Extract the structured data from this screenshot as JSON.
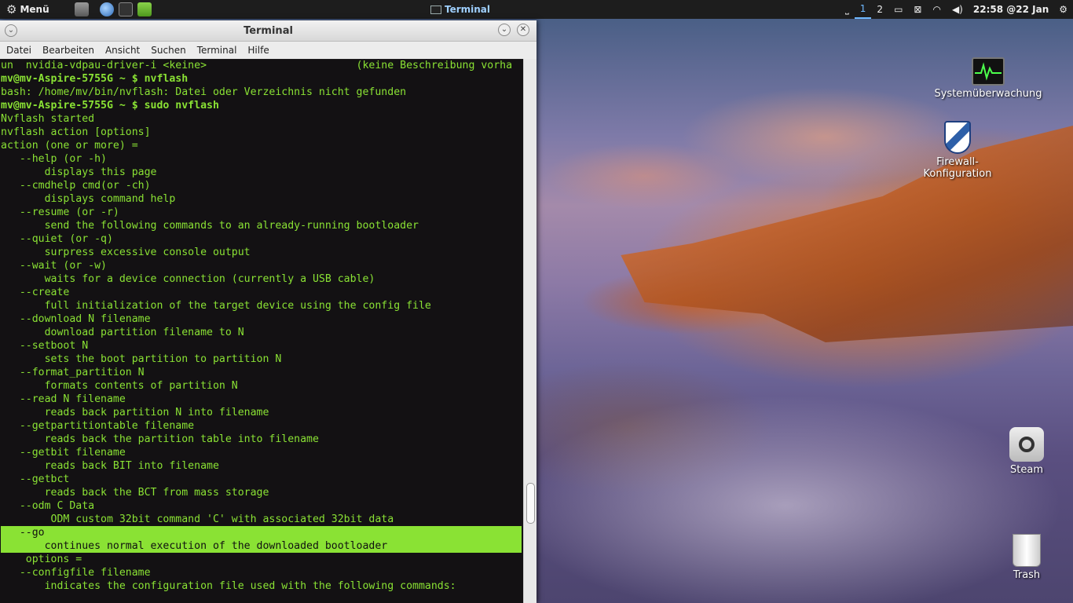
{
  "top_panel": {
    "menu_label": "Menü",
    "taskbar_active": "Terminal",
    "workspaces": [
      "1",
      "2"
    ],
    "clock": "22:58 @22 Jan",
    "icons": {
      "menu": "gear-icon",
      "files": "file-manager-icon",
      "browser": "browser-icon",
      "monitor": "system-monitor-icon",
      "folder": "folder-icon",
      "show_desktop": "show-desktop-icon",
      "display": "display-icon",
      "screen_off": "screen-off-icon",
      "wifi": "wifi-icon",
      "volume": "volume-icon",
      "settings": "settings-icon"
    }
  },
  "window": {
    "title": "Terminal",
    "menus": [
      "Datei",
      "Bearbeiten",
      "Ansicht",
      "Suchen",
      "Terminal",
      "Hilfe"
    ]
  },
  "terminal": {
    "lines": [
      {
        "t": "un  nvidia-vdpau-driver-i <keine>                        (keine Beschreibung vorha"
      },
      {
        "t": "mv@mv-Aspire-5755G ~ $ nvflash",
        "b": true
      },
      {
        "t": "bash: /home/mv/bin/nvflash: Datei oder Verzeichnis nicht gefunden"
      },
      {
        "t": "mv@mv-Aspire-5755G ~ $ sudo nvflash",
        "b": true
      },
      {
        "t": "Nvflash started"
      },
      {
        "t": "nvflash action [options]"
      },
      {
        "t": "action (one or more) ="
      },
      {
        "t": "   --help (or -h)"
      },
      {
        "t": "       displays this page"
      },
      {
        "t": "   --cmdhelp cmd(or -ch)"
      },
      {
        "t": "       displays command help"
      },
      {
        "t": "   --resume (or -r)"
      },
      {
        "t": "       send the following commands to an already-running bootloader"
      },
      {
        "t": "   --quiet (or -q)"
      },
      {
        "t": "       surpress excessive console output"
      },
      {
        "t": "   --wait (or -w)"
      },
      {
        "t": "       waits for a device connection (currently a USB cable)"
      },
      {
        "t": "   --create"
      },
      {
        "t": "       full initialization of the target device using the config file"
      },
      {
        "t": "   --download N filename"
      },
      {
        "t": "       download partition filename to N"
      },
      {
        "t": "   --setboot N"
      },
      {
        "t": "       sets the boot partition to partition N"
      },
      {
        "t": "   --format_partition N"
      },
      {
        "t": "       formats contents of partition N"
      },
      {
        "t": "   --read N filename"
      },
      {
        "t": "       reads back partition N into filename"
      },
      {
        "t": "   --getpartitiontable filename"
      },
      {
        "t": "       reads back the partition table into filename"
      },
      {
        "t": "   --getbit filename"
      },
      {
        "t": "       reads back BIT into filename"
      },
      {
        "t": "   --getbct"
      },
      {
        "t": "       reads back the BCT from mass storage"
      },
      {
        "t": "   --odm C Data"
      },
      {
        "t": "        ODM custom 32bit command 'C' with associated 32bit data"
      },
      {
        "t": "   --go",
        "hl": true
      },
      {
        "t": "       continues normal execution of the downloaded bootloader",
        "hl": true
      },
      {
        "t": "    options ="
      },
      {
        "t": "   --configfile filename"
      },
      {
        "t": "       indicates the configuration file used with the following commands:"
      }
    ]
  },
  "desktop_icons": [
    {
      "label": "Systemüberwachung",
      "icon": "system-monitor-icon"
    },
    {
      "label": "Firewall-Konfiguration",
      "icon": "firewall-shield-icon"
    },
    {
      "label": "Steam",
      "icon": "steam-icon"
    },
    {
      "label": "Trash",
      "icon": "trash-icon"
    }
  ],
  "colors": {
    "terminal_text": "#8ae234",
    "terminal_bg": "#121012",
    "panel_bg": "#1d1d1d",
    "active_workspace": "#6fb8ff"
  }
}
